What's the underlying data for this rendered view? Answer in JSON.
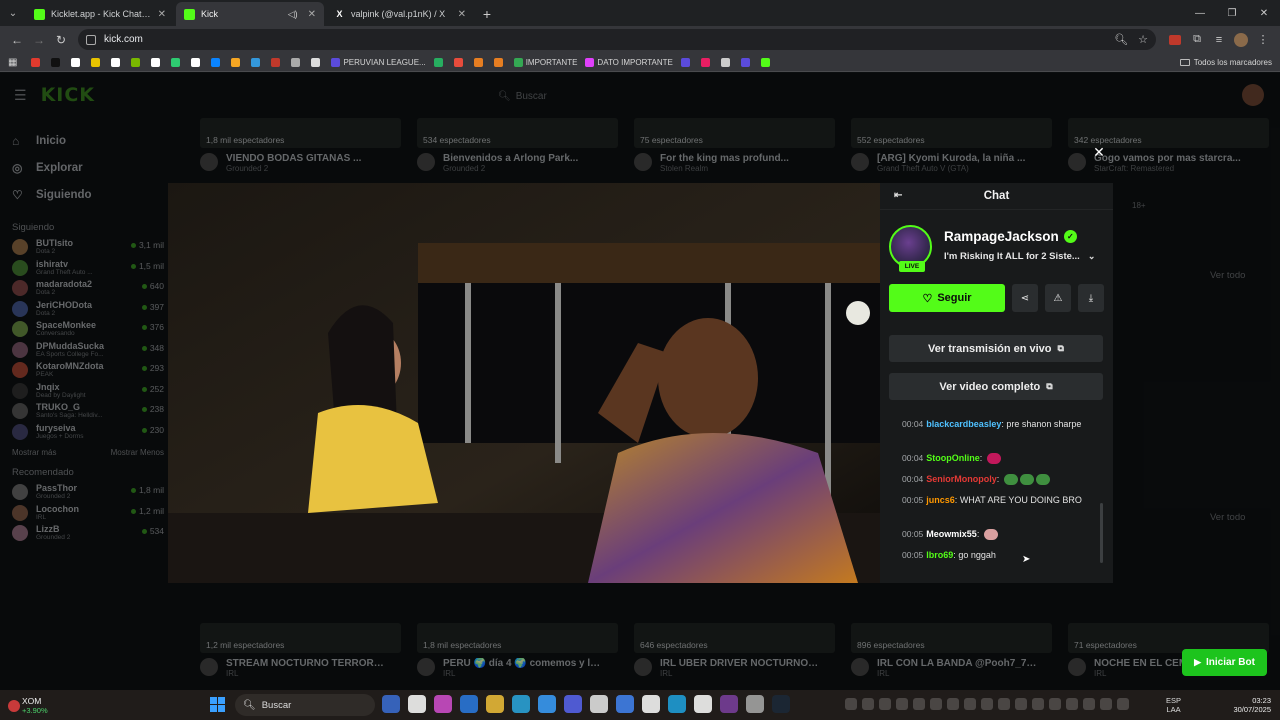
{
  "browser": {
    "tabs": [
      {
        "title": "Kicklet.app - Kick Chatbot and",
        "active": false,
        "favicon_color": "#53fc18"
      },
      {
        "title": "Kick",
        "active": true,
        "favicon_color": "#53fc18"
      },
      {
        "title": "valpink (@val.p1nK) / X",
        "active": false,
        "favicon_color": "#ffffff"
      }
    ],
    "url": "kick.com",
    "bookmarks": [
      {
        "label": "",
        "color": "#e03a2e"
      },
      {
        "label": "",
        "color": "#111111"
      },
      {
        "label": "",
        "color": "#ffffff"
      },
      {
        "label": "",
        "color": "#e7c300"
      },
      {
        "label": "",
        "color": "#ffffff"
      },
      {
        "label": "",
        "color": "#7ab800"
      },
      {
        "label": "",
        "color": "#ffffff"
      },
      {
        "label": "",
        "color": "#2ecc71"
      },
      {
        "label": "",
        "color": "#ffffff"
      },
      {
        "label": "",
        "color": "#0a84ff"
      },
      {
        "label": "",
        "color": "#f5a623"
      },
      {
        "label": "",
        "color": "#3498db"
      },
      {
        "label": "",
        "color": "#c0392b"
      },
      {
        "label": "",
        "color": "#aaaaaa"
      },
      {
        "label": "",
        "color": "#dddddd"
      },
      {
        "label": "PERUVIAN LEAGUE...",
        "color": "#5b4bdb"
      },
      {
        "label": "",
        "color": "#27ae60"
      },
      {
        "label": "",
        "color": "#e74c3c"
      },
      {
        "label": "",
        "color": "#e67e22"
      },
      {
        "label": "",
        "color": "#e67e22"
      },
      {
        "label": "IMPORTANTE",
        "color": "#34a853"
      },
      {
        "label": "DATO IMPORTANTE",
        "color": "#e040fb"
      },
      {
        "label": "",
        "color": "#5b4bdb"
      },
      {
        "label": "",
        "color": "#e91e63"
      },
      {
        "label": "",
        "color": "#cccccc"
      },
      {
        "label": "",
        "color": "#5b4bdb"
      },
      {
        "label": "",
        "color": "#53fc18"
      }
    ],
    "bookmarks_folder": "Todos los marcadores"
  },
  "kick": {
    "search_placeholder": "Buscar",
    "nav": [
      {
        "label": "Inicio",
        "icon": "home-icon"
      },
      {
        "label": "Explorar",
        "icon": "compass-icon"
      },
      {
        "label": "Siguiendo",
        "icon": "heart-icon"
      }
    ],
    "following_title": "Siguiendo",
    "following": [
      {
        "name": "BUTIsito",
        "game": "Dota 2",
        "viewers": "3,1 mil",
        "color": "#7a5a3a"
      },
      {
        "name": "ishiratv",
        "game": "Grand Theft Auto ...",
        "viewers": "1,5 mil",
        "color": "#3a6a2a"
      },
      {
        "name": "madaradota2",
        "game": "Dota 2",
        "viewers": "640",
        "color": "#6a3a3a"
      },
      {
        "name": "JeriCHODota",
        "game": "Dota 2",
        "viewers": "397",
        "color": "#3a4a7a"
      },
      {
        "name": "SpaceMonkee",
        "game": "Conversando",
        "viewers": "376",
        "color": "#5a7a3a"
      },
      {
        "name": "DPMuddaSucka",
        "game": "EA Sports College Fo...",
        "viewers": "348",
        "color": "#6a4a5a"
      },
      {
        "name": "KotaroMNZdota",
        "game": "PEAK",
        "viewers": "293",
        "color": "#8a3a2a"
      },
      {
        "name": "Jnqix",
        "game": "Dead by Daylight",
        "viewers": "252",
        "color": "#2a2a2a"
      },
      {
        "name": "TRUKO_G",
        "game": "Santo's Saga: Helldiv...",
        "viewers": "238",
        "color": "#4a4a4a"
      },
      {
        "name": "furyseiva",
        "game": "Juegos + Dorms",
        "viewers": "230",
        "color": "#3a3a5a"
      }
    ],
    "show_more": "Mostrar más",
    "show_less": "Mostrar Menos",
    "recommended_title": "Recomendado",
    "recommended": [
      {
        "name": "PassThor",
        "game": "Grounded 2",
        "viewers": "1,8 mil",
        "color": "#5a5a5a"
      },
      {
        "name": "Locochon",
        "game": "IRL",
        "viewers": "1,2 mil",
        "color": "#6a4a3a"
      },
      {
        "name": "LizzB",
        "game": "Grounded 2",
        "viewers": "534",
        "color": "#7a5a6a"
      }
    ],
    "top_cards": [
      {
        "views": "1,8 mil espectadores",
        "title": "VIENDO BODAS GITANAS ...",
        "game": "Grounded 2"
      },
      {
        "views": "534 espectadores",
        "title": "Bienvenidos a Arlong Park...",
        "game": "Grounded 2"
      },
      {
        "views": "75 espectadores",
        "title": "For the king mas profund...",
        "game": "Stolen Realm"
      },
      {
        "views": "552 espectadores",
        "title": "[ARG] Kyomi Kuroda, la niña ...",
        "game": "Grand Theft Auto V (GTA)"
      },
      {
        "views": "342 espectadores",
        "title": "Gogo vamos por mas starcra...",
        "game": "StarCraft: Remastered"
      }
    ],
    "bottom_cards": [
      {
        "views": "1,2 mil espectadores",
        "title": "STREAM NOCTURNO TERRORIF...",
        "game": "IRL"
      },
      {
        "views": "1,8 mil espectadores",
        "title": "PERU 🌍 día 4 🌍 comemos y lu...",
        "game": "IRL"
      },
      {
        "views": "646 espectadores",
        "title": "IRL UBER DRIVER NOCTURNO 🌍",
        "game": "IRL"
      },
      {
        "views": "896 espectadores",
        "title": "IRL CON LA BANDA @Pooh7_7 ...",
        "game": "IRL"
      },
      {
        "views": "71 espectadores",
        "title": "NOCHE EN EL CEMEN...",
        "game": "IRL"
      }
    ],
    "see_all_1": "Ver todo",
    "see_all_2": "Ver todo",
    "right_peek_age": "18+",
    "bot_button": "Iniciar Bot"
  },
  "chat": {
    "header": "Chat",
    "streamer": "RampageJackson",
    "live_badge": "LIVE",
    "stream_title": "I'm Risking It ALL for 2 Siste...",
    "follow_label": "Seguir",
    "watch_live": "Ver transmisión en vivo",
    "watch_full": "Ver video completo",
    "messages": [
      {
        "time": "00:04",
        "user": "blackcardbeasley",
        "color": "#4fc1ff",
        "text": "pre shanon sharpe",
        "emotes": []
      },
      {
        "time": "00:04",
        "user": "StoopOnline",
        "color": "#53fc18",
        "text": "",
        "emotes": [
          "#c2185b"
        ]
      },
      {
        "time": "00:04",
        "user": "SeniorMonopoly",
        "color": "#e53935",
        "text": "",
        "emotes": [
          "#3f8f3f",
          "#3f8f3f",
          "#3f8f3f"
        ]
      },
      {
        "time": "00:05",
        "user": "juncs6",
        "color": "#ff9800",
        "text": "WHAT ARE YOU DOING BRO",
        "emotes": []
      },
      {
        "time": "00:05",
        "user": "Meowmix55",
        "color": "#ffffff",
        "text": "",
        "emotes": [
          "#d9a0a0"
        ]
      },
      {
        "time": "00:05",
        "user": "lbro69",
        "color": "#53fc18",
        "text": "go nggah",
        "emotes": []
      }
    ]
  },
  "taskbar": {
    "stock_symbol": "XOM",
    "stock_change": "+3.90%",
    "search": "Buscar",
    "lang_1": "ESP",
    "lang_2": "LAA",
    "time": "03:23",
    "date": "30/07/2025"
  }
}
